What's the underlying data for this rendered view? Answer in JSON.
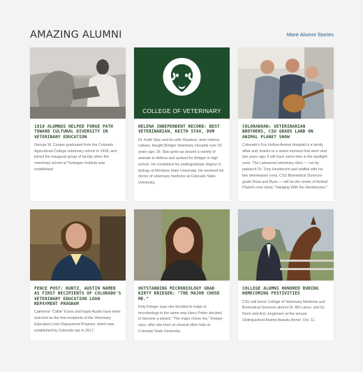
{
  "section": {
    "title": "AMAZING ALUMNI",
    "more_link": "More Alumni Stories"
  },
  "logo": {
    "caption": "COLLEGE OF VETERINARY",
    "brand_color": "#1e4d2b"
  },
  "cards": [
    {
      "title": "1918 alumnus helped forge path toward cultural diversity in veterinary education",
      "text": "George W. Cooper graduated from the Colorado Agricultural College veterinary school in 1918, and joined the inaugural group of faculty when the veterinary school at Tuskegee Institute was established."
    },
    {
      "title": "Helena Independent Record: Best Veterinarian, Keith Stav, DVM",
      "text": "Dr. Keith Stav and his wife Sharleen, both Helena natives, bought Bridger Veterinary Hospital over 20 years ago. Dr. Stav grew up around a variety of animals in Helena and worked for Bridger in high school. He completed his undergraduate degree in biology at Montana State University. He received his doctor of veterinary medicine at Colorado State University."
    },
    {
      "title": "Coloradoan: Veterinarian brothers, CSU grads land on Animal Planet show",
      "text": "Colorado's Fox Hollow Animal Hospital is a family affair and, thanks to a sweet moment that went viral two years ago, it will have some time in the spotlight soon. The Lakewood veterinary clinic — run by patriarch Dr. Tony Henderson and staffed with his two veterinarian sons, CSU Biomedical Sciences grads Ross and Ryan — will be the center of Animal Planet's new show, \"Hanging With the Hendersons.\""
    },
    {
      "title": "Fence Post: Kuntz, Austin named as first recipients of Colorado's Veterinary Education Loan Repayment Program",
      "text": "Catherine \"Callie\" Kuntz and Kayle Austin have been selected as the first recipients of the Veterinary Education Loan Repayment Program, which was established by Colorado law in 2017."
    },
    {
      "title": "Outstanding microbiology grad Kirty Krieger: \"The major chose me.\"",
      "text": "Kirty Krieger says she decided to major in microbiology in the same way Harry Potter decided to become a wizard. \"The major chose me,\" Krieger says, after she tried on several other hats at Colorado State University."
    },
    {
      "title": "College alumni honored during Homecoming festivities",
      "text": "CSU will honor College of Veterinary Medicine and Biomedical Sciences alumni Dr. Bill Lance, and Dr. Norm and Ann Jorgensen at the annual Distinguished Alumni Awards dinner, Oct. 11."
    }
  ]
}
